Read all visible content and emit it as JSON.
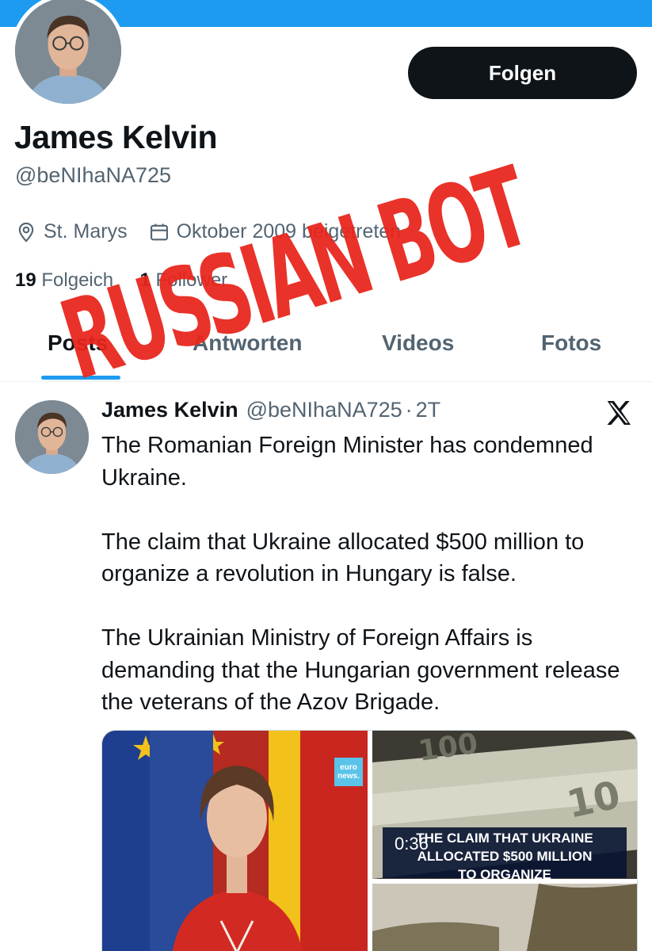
{
  "profile": {
    "display_name": "James Kelvin",
    "handle": "@beNIhaNA725",
    "follow_label": "Folgen",
    "location": "St. Marys",
    "joined": "Oktober 2009 beigetreten",
    "following_count": "19",
    "following_label": "Folgeich",
    "followers_count": "1",
    "followers_label": "Follower"
  },
  "overlay": {
    "stamp_text": "RUSSIAN BOT",
    "stamp_color": "#e8261c"
  },
  "tabs": [
    {
      "label": "Posts",
      "active": true
    },
    {
      "label": "Antworten",
      "active": false
    },
    {
      "label": "Videos",
      "active": false
    },
    {
      "label": "Fotos",
      "active": false
    }
  ],
  "tweet": {
    "name": "James Kelvin",
    "handle": "@beNIhaNA725",
    "separator": "·",
    "time": "2T",
    "paragraphs": [
      "The Romanian Foreign Minister has condemned Ukraine.",
      "The claim that Ukraine allocated $500 million to organize a revolution in Hungary is false.",
      "The Ukrainian Ministry of Foreign Affairs is demanding that the Hungarian government release the veterans of the Azov Brigade."
    ],
    "media": {
      "logo_line1": "euro",
      "logo_line2": "news.",
      "video_duration": "0:36",
      "caption_lines": [
        "THE CLAIM THAT UKRAINE",
        "ALLOCATED $500 MILLION",
        "TO ORGANIZE"
      ]
    }
  },
  "colors": {
    "accent": "#1d9bf0",
    "text": "#0f1419",
    "muted": "#536471",
    "button": "#0f1419"
  },
  "icons": [
    "location-pin-icon",
    "calendar-icon",
    "x-logo-icon"
  ]
}
